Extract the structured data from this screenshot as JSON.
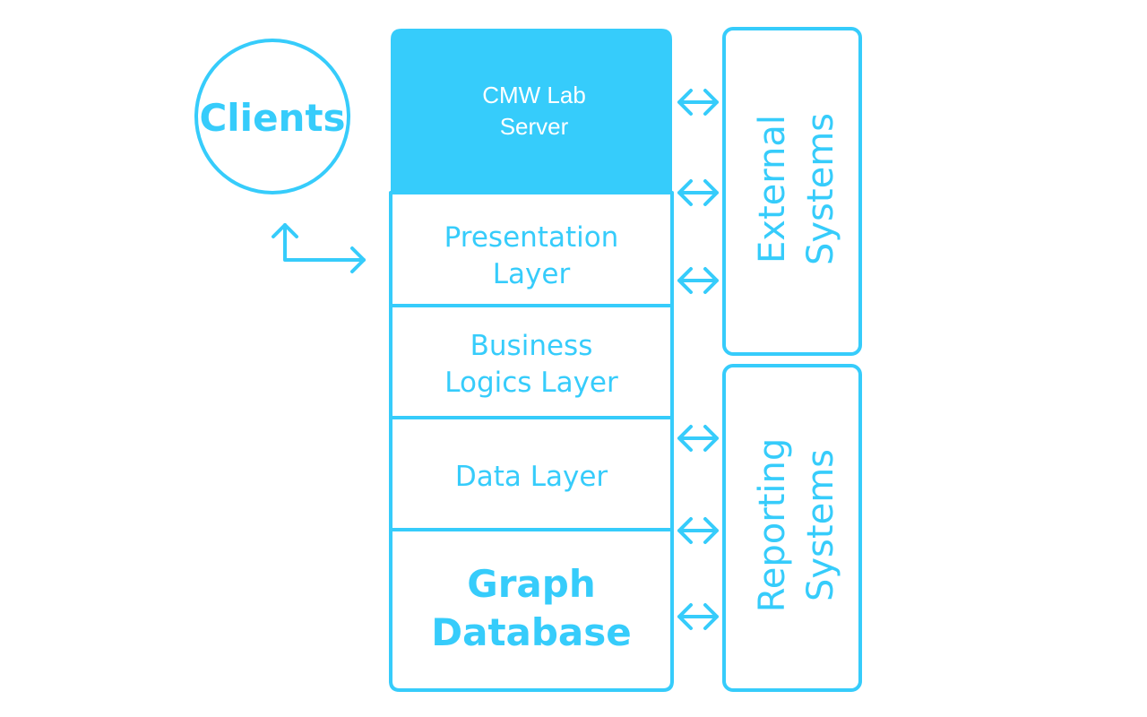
{
  "accent_color": "#36ccfb",
  "clients": {
    "label": "Clients"
  },
  "server": {
    "line1": "CMW Lab",
    "line2": "Server"
  },
  "layers": {
    "presentation": {
      "line1": "Presentation",
      "line2": "Layer"
    },
    "business": {
      "line1": "Business",
      "line2": "Logics Layer"
    },
    "data": {
      "line1": "Data Layer"
    },
    "graph_db": {
      "line1": "Graph",
      "line2": "Database"
    }
  },
  "external": {
    "line1": "External",
    "line2": "Systems"
  },
  "reporting": {
    "line1": "Reporting",
    "line2": "Systems"
  },
  "connectors": [
    "bidirectional-arrow",
    "bidirectional-arrow",
    "bidirectional-arrow",
    "bidirectional-arrow",
    "bidirectional-arrow",
    "bidirectional-arrow"
  ]
}
